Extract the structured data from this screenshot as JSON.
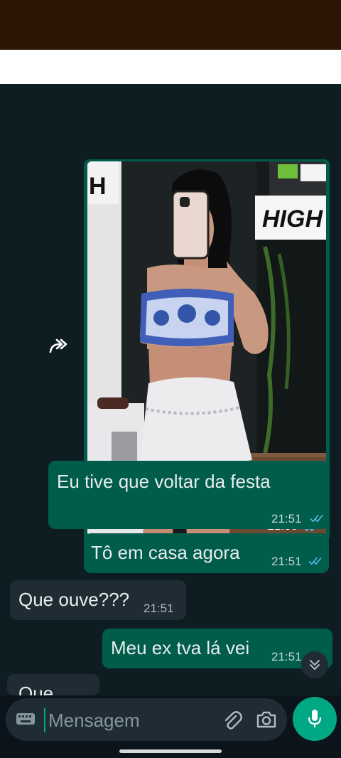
{
  "messages": [
    {
      "direction": "out",
      "text": "Eu tive que voltar da festa",
      "time": "21:51",
      "status": "read"
    },
    {
      "direction": "out",
      "text": "Tô em casa agora",
      "time": "21:51",
      "status": "read"
    },
    {
      "direction": "in",
      "text": "Que ouve???",
      "time": "21:51"
    },
    {
      "direction": "out",
      "text": "Meu ex tva lá vei",
      "time": "21:51",
      "status": "read"
    },
    {
      "direction": "in",
      "text": "Que",
      "partial": true
    }
  ],
  "image_message": {
    "time": "21:50",
    "status": "read",
    "sign_text": "HIGH"
  },
  "composer": {
    "placeholder": "Mensagem"
  },
  "colors": {
    "outgoing": "#005c4b",
    "incoming": "#202c33",
    "accent": "#00a884",
    "read_ticks": "#53bdeb"
  },
  "icons": [
    "forward-icon",
    "double-check-icon",
    "chevron-double-down-icon",
    "keyboard-icon",
    "paperclip-icon",
    "camera-icon",
    "microphone-icon"
  ]
}
